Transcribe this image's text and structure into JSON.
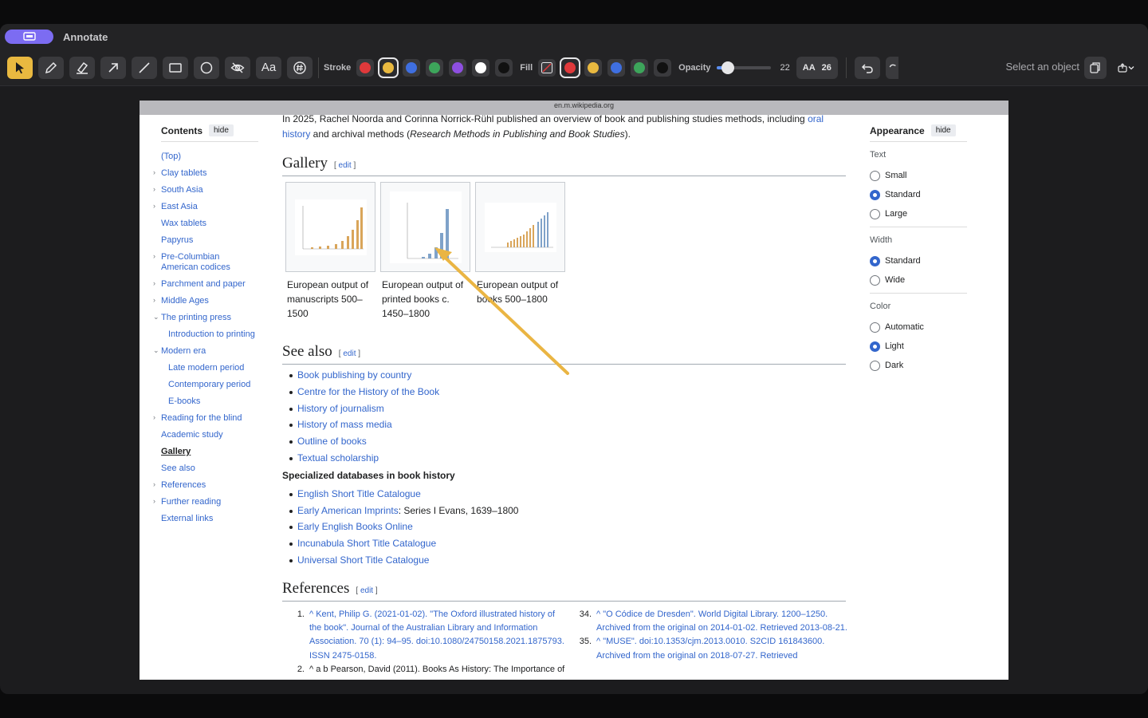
{
  "app": {
    "title": "Annotate"
  },
  "toolbar": {
    "stroke_label": "Stroke",
    "fill_label": "Fill",
    "opacity_label": "Opacity",
    "opacity_value": 22,
    "font_size_label": "AA",
    "font_size_value": "26",
    "text_tool_label": "Aa",
    "status": "Select an object",
    "stroke_colors": [
      "#e0393b",
      "#e9b940",
      "#3f6fe0",
      "#3da55b",
      "#8e4fe0",
      "#ffffff",
      "#111111"
    ],
    "fill_colors": [
      "#e0393b",
      "#e9b940",
      "#3f6fe0",
      "#3da55b",
      "#111111"
    ],
    "accent": "#e9b940"
  },
  "browser": {
    "url": "en.m.wikipedia.org"
  },
  "toc": {
    "title": "Contents",
    "hide": "hide",
    "items": [
      {
        "label": "(Top)",
        "caret": "",
        "sub": false
      },
      {
        "label": "Clay tablets",
        "caret": "›",
        "sub": false
      },
      {
        "label": "South Asia",
        "caret": "›",
        "sub": false
      },
      {
        "label": "East Asia",
        "caret": "›",
        "sub": false
      },
      {
        "label": "Wax tablets",
        "caret": "",
        "sub": false
      },
      {
        "label": "Papyrus",
        "caret": "",
        "sub": false
      },
      {
        "label": "Pre-Columbian American codices",
        "caret": "›",
        "sub": false
      },
      {
        "label": "Parchment and paper",
        "caret": "›",
        "sub": false
      },
      {
        "label": "Middle Ages",
        "caret": "›",
        "sub": false
      },
      {
        "label": "The printing press",
        "caret": "⌄",
        "sub": false
      },
      {
        "label": "Introduction to printing",
        "caret": "",
        "sub": true
      },
      {
        "label": "Modern era",
        "caret": "⌄",
        "sub": false
      },
      {
        "label": "Late modern period",
        "caret": "",
        "sub": true
      },
      {
        "label": "Contemporary period",
        "caret": "",
        "sub": true
      },
      {
        "label": "E-books",
        "caret": "",
        "sub": true
      },
      {
        "label": "Reading for the blind",
        "caret": "›",
        "sub": false
      },
      {
        "label": "Academic study",
        "caret": "",
        "sub": false
      },
      {
        "label": "Gallery",
        "caret": "",
        "sub": false,
        "current": true
      },
      {
        "label": "See also",
        "caret": "",
        "sub": false
      },
      {
        "label": "References",
        "caret": "›",
        "sub": false
      },
      {
        "label": "Further reading",
        "caret": "›",
        "sub": false
      },
      {
        "label": "External links",
        "caret": "",
        "sub": false
      }
    ]
  },
  "article": {
    "intro_a": "In 2025, Rachel Noorda and Corinna Norrick-Rühl published an overview of book and publishing studies methods, including ",
    "intro_link": "oral history",
    "intro_b": " and archival methods (",
    "intro_italic": "Research Methods in Publishing and Book Studies",
    "intro_c": ").",
    "gallery_heading": "Gallery",
    "edit_label": "edit",
    "gallery": [
      {
        "caption": "European output of manuscripts 500–1500"
      },
      {
        "caption": "European output of printed books c. 1450–1800"
      },
      {
        "caption": "European output of books 500–1800"
      }
    ],
    "see_also_heading": "See also",
    "see_also": [
      "Book publishing by country",
      "Centre for the History of the Book",
      "History of journalism",
      "History of mass media",
      "Outline of books",
      "Textual scholarship"
    ],
    "db_heading": "Specialized databases in book history",
    "databases": [
      {
        "link": "English Short Title Catalogue",
        "rest": ""
      },
      {
        "link": "Early American Imprints",
        "rest": ": Series I Evans, 1639–1800"
      },
      {
        "link": "Early English Books Online",
        "rest": ""
      },
      {
        "link": "Incunabula Short Title Catalogue",
        "rest": ""
      },
      {
        "link": "Universal Short Title Catalogue",
        "rest": ""
      }
    ],
    "references_heading": "References",
    "ref1_num": "1.",
    "ref1": "^ Kent, Philip G. (2021-01-02). \"The Oxford illustrated history of the book\". Journal of the Australian Library and Information Association. 70 (1): 94–95. doi:10.1080/24750158.2021.1875793. ISSN 2475-0158.",
    "ref2_num": "2.",
    "ref2": "^ a b Pearson, David (2011). Books As History: The Importance of",
    "ref34_num": "34.",
    "ref34": "^ \"O Códice de Dresden\". World Digital Library. 1200–1250. Archived from the original on 2014-01-02. Retrieved 2013-08-21.",
    "ref35_num": "35.",
    "ref35": "^ \"MUSE\". doi:10.1353/cjm.2013.0010. S2CID 161843600. Archived from the original on 2018-07-27. Retrieved"
  },
  "appearance": {
    "title": "Appearance",
    "hide": "hide",
    "text_label": "Text",
    "text_options": [
      "Small",
      "Standard",
      "Large"
    ],
    "text_selected": 1,
    "width_label": "Width",
    "width_options": [
      "Standard",
      "Wide"
    ],
    "width_selected": 0,
    "color_label": "Color",
    "color_options": [
      "Automatic",
      "Light",
      "Dark"
    ],
    "color_selected": 1
  }
}
